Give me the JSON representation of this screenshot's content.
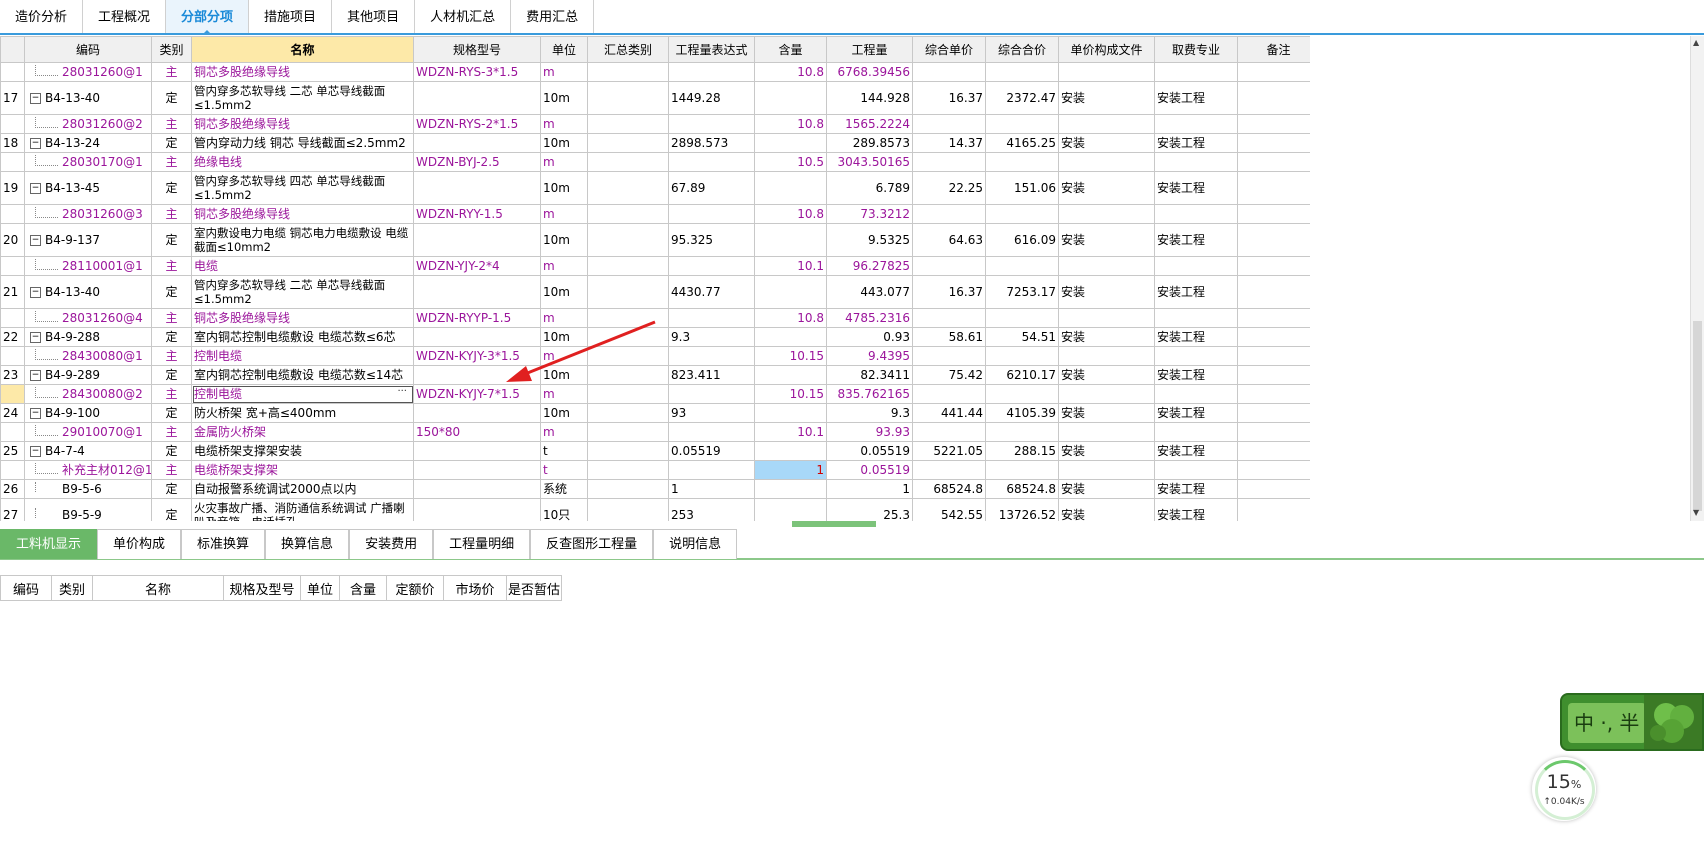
{
  "top_tabs": [
    "造价分析",
    "工程概况",
    "分部分项",
    "措施项目",
    "其他项目",
    "人材机汇总",
    "费用汇总"
  ],
  "active_top_tab": "分部分项",
  "grid_headers": [
    "",
    "编码",
    "类别",
    "名称",
    "规格型号",
    "单位",
    "汇总类别",
    "工程量表达式",
    "含量",
    "工程量",
    "综合单价",
    "综合合价",
    "单价构成文件",
    "取费专业",
    "备注"
  ],
  "rows": [
    {
      "kind": "sub",
      "idx": "",
      "code": "28031260@1",
      "cat": "主",
      "name": "铜芯多股绝缘导线",
      "spec": "WDZN-RYS-3*1.5",
      "unit": "m",
      "expr": "",
      "qty_ratio": "10.8",
      "qty": "6768.39456",
      "price": "",
      "total": "",
      "file": "",
      "prof": ""
    },
    {
      "kind": "main",
      "tall": true,
      "idx": "17",
      "code": "B4-13-40",
      "cat": "定",
      "name": "管内穿多芯软导线 二芯 单芯导线截面≤1.5mm2",
      "spec": "",
      "unit": "10m",
      "expr": "1449.28",
      "qty_ratio": "",
      "qty": "144.928",
      "price": "16.37",
      "total": "2372.47",
      "file": "安装",
      "prof": "安装工程"
    },
    {
      "kind": "sub",
      "idx": "",
      "code": "28031260@2",
      "cat": "主",
      "name": "铜芯多股绝缘导线",
      "spec": "WDZN-RYS-2*1.5",
      "unit": "m",
      "expr": "",
      "qty_ratio": "10.8",
      "qty": "1565.2224",
      "price": "",
      "total": "",
      "file": "",
      "prof": ""
    },
    {
      "kind": "main",
      "idx": "18",
      "code": "B4-13-24",
      "cat": "定",
      "name": "管内穿动力线 铜芯 导线截面≤2.5mm2",
      "spec": "",
      "unit": "10m",
      "expr": "2898.573",
      "qty_ratio": "",
      "qty": "289.8573",
      "price": "14.37",
      "total": "4165.25",
      "file": "安装",
      "prof": "安装工程"
    },
    {
      "kind": "sub",
      "idx": "",
      "code": "28030170@1",
      "cat": "主",
      "name": "绝缘电线",
      "spec": "WDZN-BYJ-2.5",
      "unit": "m",
      "expr": "",
      "qty_ratio": "10.5",
      "qty": "3043.50165",
      "price": "",
      "total": "",
      "file": "",
      "prof": ""
    },
    {
      "kind": "main",
      "tall": true,
      "idx": "19",
      "code": "B4-13-45",
      "cat": "定",
      "name": "管内穿多芯软导线 四芯 单芯导线截面≤1.5mm2",
      "spec": "",
      "unit": "10m",
      "expr": "67.89",
      "qty_ratio": "",
      "qty": "6.789",
      "price": "22.25",
      "total": "151.06",
      "file": "安装",
      "prof": "安装工程"
    },
    {
      "kind": "sub",
      "idx": "",
      "code": "28031260@3",
      "cat": "主",
      "name": "铜芯多股绝缘导线",
      "spec": "WDZN-RYY-1.5",
      "unit": "m",
      "expr": "",
      "qty_ratio": "10.8",
      "qty": "73.3212",
      "price": "",
      "total": "",
      "file": "",
      "prof": ""
    },
    {
      "kind": "main",
      "tall": true,
      "idx": "20",
      "code": "B4-9-137",
      "cat": "定",
      "name": "室内敷设电力电缆 铜芯电力电缆敷设 电缆截面≤10mm2",
      "spec": "",
      "unit": "10m",
      "expr": "95.325",
      "qty_ratio": "",
      "qty": "9.5325",
      "price": "64.63",
      "total": "616.09",
      "file": "安装",
      "prof": "安装工程"
    },
    {
      "kind": "sub",
      "idx": "",
      "code": "28110001@1",
      "cat": "主",
      "name": "电缆",
      "spec": "WDZN-YJY-2*4",
      "unit": "m",
      "expr": "",
      "qty_ratio": "10.1",
      "qty": "96.27825",
      "price": "",
      "total": "",
      "file": "",
      "prof": ""
    },
    {
      "kind": "main",
      "tall": true,
      "idx": "21",
      "code": "B4-13-40",
      "cat": "定",
      "name": "管内穿多芯软导线 二芯 单芯导线截面≤1.5mm2",
      "spec": "",
      "unit": "10m",
      "expr": "4430.77",
      "qty_ratio": "",
      "qty": "443.077",
      "price": "16.37",
      "total": "7253.17",
      "file": "安装",
      "prof": "安装工程"
    },
    {
      "kind": "sub",
      "idx": "",
      "code": "28031260@4",
      "cat": "主",
      "name": "铜芯多股绝缘导线",
      "spec": "WDZN-RYYP-1.5",
      "unit": "m",
      "expr": "",
      "qty_ratio": "10.8",
      "qty": "4785.2316",
      "price": "",
      "total": "",
      "file": "",
      "prof": ""
    },
    {
      "kind": "main",
      "idx": "22",
      "code": "B4-9-288",
      "cat": "定",
      "name": "室内铜芯控制电缆敷设 电缆芯数≤6芯",
      "spec": "",
      "unit": "10m",
      "expr": "9.3",
      "qty_ratio": "",
      "qty": "0.93",
      "price": "58.61",
      "total": "54.51",
      "file": "安装",
      "prof": "安装工程"
    },
    {
      "kind": "sub",
      "idx": "",
      "code": "28430080@1",
      "cat": "主",
      "name": "控制电缆",
      "spec": "WDZN-KYJY-3*1.5",
      "unit": "m",
      "expr": "",
      "qty_ratio": "10.15",
      "qty": "9.4395",
      "price": "",
      "total": "",
      "file": "",
      "prof": ""
    },
    {
      "kind": "main",
      "idx": "23",
      "code": "B4-9-289",
      "cat": "定",
      "name": "室内铜芯控制电缆敷设 电缆芯数≤14芯",
      "spec": "",
      "unit": "10m",
      "expr": "823.411",
      "qty_ratio": "",
      "qty": "82.3411",
      "price": "75.42",
      "total": "6210.17",
      "file": "安装",
      "prof": "安装工程"
    },
    {
      "kind": "sub",
      "selected": true,
      "idx": "",
      "code": "28430080@2",
      "cat": "主",
      "name": "控制电缆",
      "spec": "WDZN-KYJY-7*1.5",
      "unit": "m",
      "expr": "",
      "qty_ratio": "10.15",
      "qty": "835.762165",
      "price": "",
      "total": "",
      "file": "",
      "prof": ""
    },
    {
      "kind": "main",
      "idx": "24",
      "code": "B4-9-100",
      "cat": "定",
      "name": "防火桥架 宽+高≤400mm",
      "spec": "",
      "unit": "10m",
      "expr": "93",
      "qty_ratio": "",
      "qty": "9.3",
      "price": "441.44",
      "total": "4105.39",
      "file": "安装",
      "prof": "安装工程"
    },
    {
      "kind": "sub",
      "idx": "",
      "code": "29010070@1",
      "cat": "主",
      "name": "金属防火桥架",
      "spec": "150*80",
      "unit": "m",
      "expr": "",
      "qty_ratio": "10.1",
      "qty": "93.93",
      "price": "",
      "total": "",
      "file": "",
      "prof": ""
    },
    {
      "kind": "main",
      "idx": "25",
      "code": "B4-7-4",
      "cat": "定",
      "name": "电缆桥架支撑架安装",
      "spec": "",
      "unit": "t",
      "expr": "0.05519",
      "qty_ratio": "",
      "qty": "0.05519",
      "price": "5221.05",
      "total": "288.15",
      "file": "安装",
      "prof": "安装工程"
    },
    {
      "kind": "sub",
      "hl": true,
      "idx": "",
      "code": "补充主材012@1",
      "cat": "主",
      "name": "电缆桥架支撑架",
      "spec": "",
      "unit": "t",
      "expr": "",
      "qty_ratio": "1",
      "qty": "0.05519",
      "price": "",
      "total": "",
      "file": "",
      "prof": ""
    },
    {
      "kind": "plain",
      "idx": "26",
      "code": "B9-5-6",
      "cat": "定",
      "name": "自动报警系统调试2000点以内",
      "spec": "",
      "unit": "系统",
      "expr": "1",
      "qty_ratio": "",
      "qty": "1",
      "price": "68524.8",
      "total": "68524.8",
      "file": "安装",
      "prof": "安装工程"
    },
    {
      "kind": "plain",
      "tall": true,
      "idx": "27",
      "code": "B9-5-9",
      "cat": "定",
      "name": "火灾事故广播、消防通信系统调试 广播喇叭及音箱、电话插孔",
      "spec": "",
      "unit": "10只",
      "expr": "253",
      "qty_ratio": "",
      "qty": "25.3",
      "price": "542.55",
      "total": "13726.52",
      "file": "安装",
      "prof": "安装工程"
    }
  ],
  "bottom_tabs": [
    "工料机显示",
    "单价构成",
    "标准换算",
    "换算信息",
    "安装费用",
    "工程量明细",
    "反查图形工程量",
    "说明信息"
  ],
  "active_bottom_tab": "工料机显示",
  "sub_headers": [
    "编码",
    "类别",
    "名称",
    "规格及型号",
    "单位",
    "含量",
    "定额价",
    "市场价",
    "是否暂估"
  ],
  "ime": {
    "text": "中 ·, 半"
  },
  "speed": {
    "percent": "15",
    "unit": "%",
    "rate": "↑0.04K/s"
  },
  "colors": {
    "accent": "#3a9bdc",
    "sub_row": "#9b159b",
    "bottom_active": "#6ab868",
    "arrow": "#e02020",
    "highlight": "#a8d8f8"
  },
  "icons": [
    "expand-minus-icon",
    "ellipsis-icon",
    "red-arrow-annotation",
    "scroll-up-arrow-icon",
    "scroll-down-arrow-icon"
  ]
}
